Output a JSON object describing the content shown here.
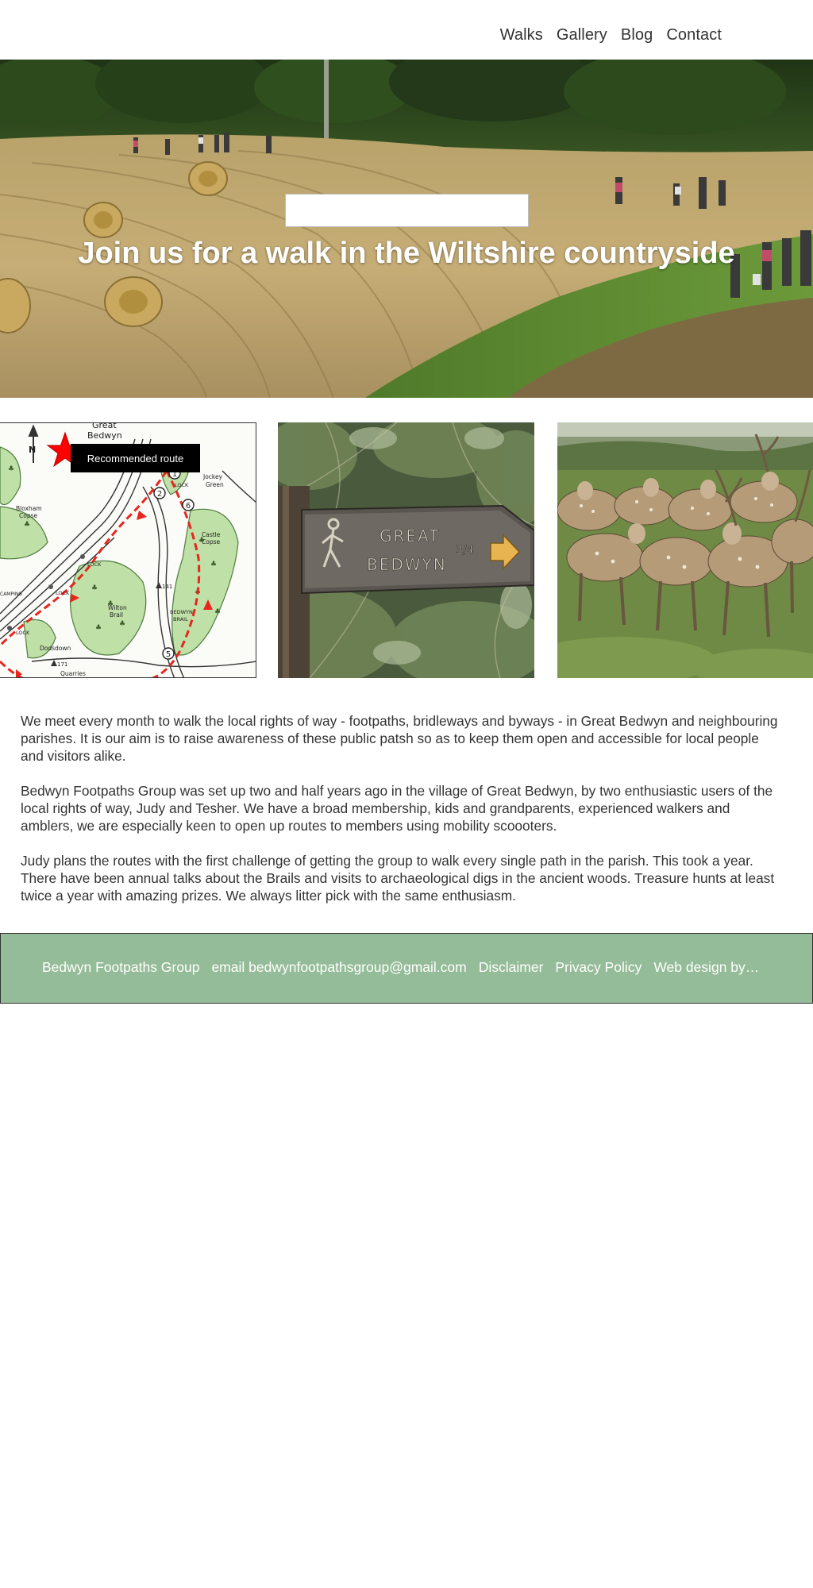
{
  "nav": {
    "items": [
      {
        "label": "Walks"
      },
      {
        "label": "Gallery"
      },
      {
        "label": "Blog"
      },
      {
        "label": "Contact"
      }
    ]
  },
  "hero": {
    "title": "Join us for a walk in the Wiltshire countryside",
    "image": "walkers-in-harvested-field"
  },
  "gallery": {
    "map": {
      "image": "walking-route-map",
      "label": "Recommended route",
      "marker_icon": "star-icon",
      "marker_color": "#ff0000",
      "map_text": [
        "Great",
        "Bedwyn",
        "Jockey",
        "Green",
        "Castle",
        "Copse",
        "Wilton",
        "Brail",
        "BEDWYN",
        "BRAIL",
        "Bloxham",
        "Copse",
        "LOCK",
        "Dodsdown",
        "Quarries",
        "N",
        "CAMPING"
      ],
      "map_numbers": [
        "1",
        "2",
        "5",
        "6",
        "141",
        "171"
      ]
    },
    "sign": {
      "image": "wooden-signpost",
      "text": [
        "GREAT",
        "BEDWYN",
        "3/4"
      ]
    },
    "deer": {
      "image": "herd-of-fallow-deer"
    }
  },
  "content": {
    "paragraphs": [
      "We meet every month to walk the local rights of way - footpaths, bridleways and byways - in Great Bedwyn and neighbouring parishes.  It is our aim is to raise awareness of these public patsh so as to keep them open and accessible for local people and visitors alike.",
      "Bedwyn Footpaths Group was set up two and half years ago in the village of Great Bedwyn, by two enthusiastic users of the local rights of way, Judy and Tesher.  We have a broad membership, kids and grandparents, experienced walkers and amblers, we are especially keen to open up routes to members using mobility scoooters.",
      "Judy plans the routes with the first challenge of getting the group to walk every single path in the parish.  This took a year.  There have been annual talks about the Brails and visits to archaeological digs in the ancient woods.  Treasure hunts at least twice a year with amazing prizes.  We always litter pick with the same enthusiasm."
    ]
  },
  "footer": {
    "items": [
      {
        "label": "Bedwyn Footpaths Group"
      },
      {
        "label": "email bedwynfootpathsgroup@gmail.com"
      },
      {
        "label": "Disclaimer"
      },
      {
        "label": "Privacy Policy"
      },
      {
        "label": "Web design by…"
      }
    ],
    "background": "#94bc98"
  },
  "colors": {
    "text": "#333333",
    "footer_bg": "#94bc98",
    "route_red": "#e8251e"
  }
}
